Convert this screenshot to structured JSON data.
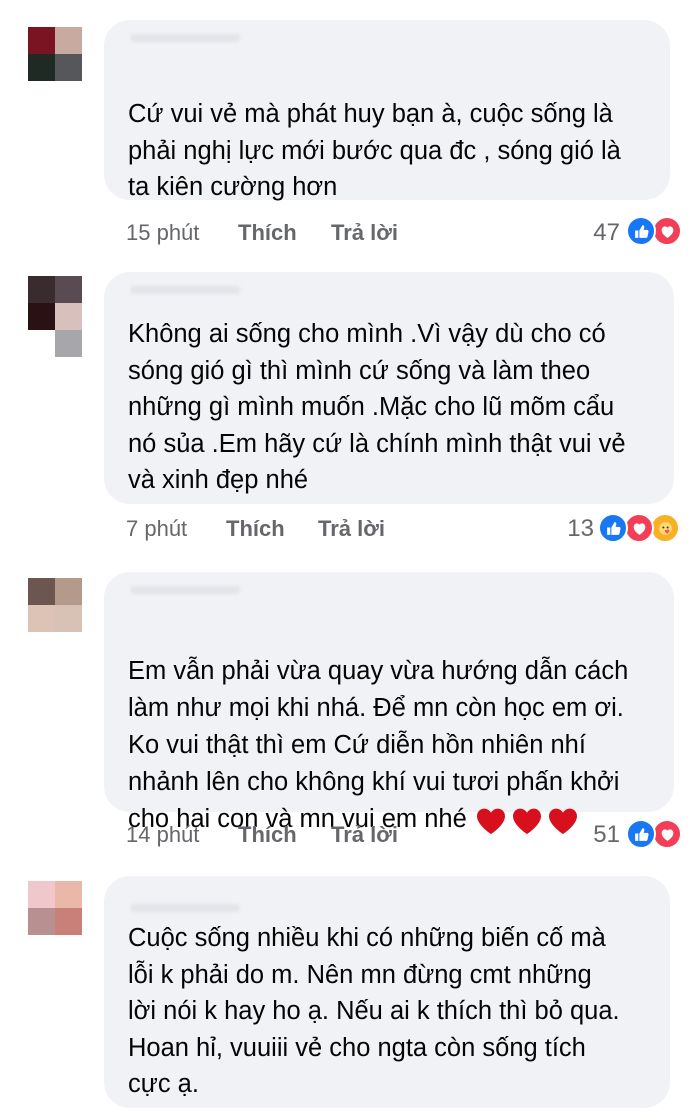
{
  "comments": [
    {
      "text": "Cứ vui vẻ mà phát huy bạn à, cuộc sống là\nphải nghị lực mới bước qua đc , sóng gió là\nta kiên cường hơn",
      "time": "15 phút",
      "like_label": "Thích",
      "reply_label": "Trả lời",
      "reaction_count": "47",
      "reactions": [
        "like-icon",
        "love-icon"
      ],
      "avatar_colors": [
        "#7a1422",
        "#c9aaa0",
        "#1f2a24",
        "#55575a"
      ]
    },
    {
      "text": "Không ai sống cho mình .Vì vậy dù cho có\nsóng gió gì thì mình cứ sống  và làm theo\nnhững gì mình muốn .Mặc cho lũ mõm cẩu\nnó sủa .Em hãy cứ là chính mình thật vui vẻ\nvà xinh đẹp nhé",
      "time": "7 phút",
      "like_label": "Thích",
      "reply_label": "Trả lời",
      "reaction_count": "13",
      "reactions": [
        "like-icon",
        "love-icon",
        "care-icon"
      ],
      "avatar_colors": [
        "#3a2b2e",
        "#5a4b52",
        "#2a1214",
        "#d8c0bd",
        "#ffffff",
        "#a7a7ab"
      ]
    },
    {
      "text": "Em vẫn phải vừa quay vừa hướng dẫn cách\nlàm như mọi khi nhá. Để mn còn học em ơi.\nKo vui thật thì em Cứ diễn hồn nhiên nhí\nnhảnh lên cho không khí vui tươi phấn khởi\ncho hai con và mn vui em nhé",
      "time": "14 phút",
      "like_label": "Thích",
      "reply_label": "Trả lời",
      "reaction_count": "51",
      "reactions": [
        "like-icon",
        "love-icon"
      ],
      "avatar_colors": [
        "#6e5650",
        "#b49a8a",
        "#dcc3b6",
        "#d8c2b6"
      ]
    },
    {
      "text": "Cuộc sống nhiều khi có những biến cố mà\nlỗi k phải do m. Nên mn đừng cmt những\nlời nói k hay ho ạ. Nếu ai k thích thì bỏ qua.\nHoan hỉ, vuuiii vẻ cho ngta còn sống tích\ncực ạ.",
      "avatar_colors": [
        "#f0c8cc",
        "#e9b8a8",
        "#b89092",
        "#c98078"
      ]
    }
  ],
  "colors": {
    "bubble": "#f0f2f5",
    "meta_text": "#65676b",
    "like_blue": "#1877f2",
    "love_red": "#f33e58",
    "heart_red": "#d8101e"
  }
}
